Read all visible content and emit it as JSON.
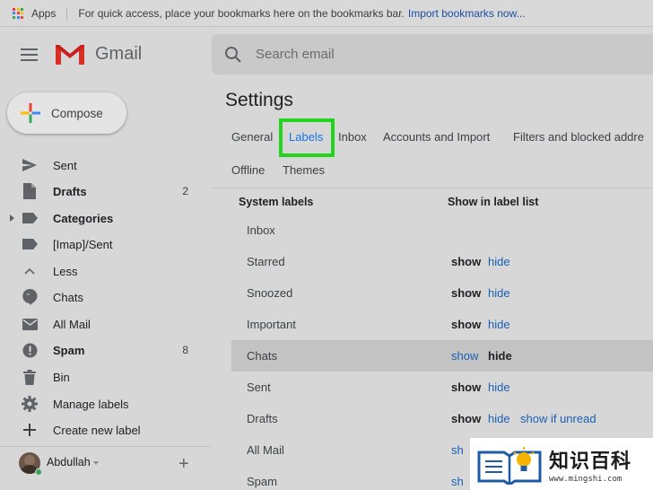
{
  "bookmarks_bar": {
    "apps_label": "Apps",
    "hint": "For quick access, place your bookmarks here on the bookmarks bar.",
    "import_link": "Import bookmarks now..."
  },
  "header": {
    "app_name": "Gmail",
    "search_placeholder": "Search email"
  },
  "compose_label": "Compose",
  "sidebar": {
    "items": [
      {
        "label": "Sent",
        "count": "",
        "icon": "send-icon",
        "bold": false
      },
      {
        "label": "Drafts",
        "count": "2",
        "icon": "draft-icon",
        "bold": true
      },
      {
        "label": "Categories",
        "count": "",
        "icon": "label-icon",
        "bold": true
      },
      {
        "label": "[Imap]/Sent",
        "count": "",
        "icon": "label-icon",
        "bold": false
      },
      {
        "label": "Less",
        "count": "",
        "icon": "chevron-up-icon",
        "bold": false
      },
      {
        "label": "Chats",
        "count": "",
        "icon": "chat-icon",
        "bold": false
      },
      {
        "label": "All Mail",
        "count": "",
        "icon": "mail-icon",
        "bold": false
      },
      {
        "label": "Spam",
        "count": "8",
        "icon": "spam-icon",
        "bold": true
      },
      {
        "label": "Bin",
        "count": "",
        "icon": "trash-icon",
        "bold": false
      },
      {
        "label": "Manage labels",
        "count": "",
        "icon": "gear-icon",
        "bold": false
      },
      {
        "label": "Create new label",
        "count": "",
        "icon": "plus-icon",
        "bold": false
      }
    ],
    "user_name": "Abdullah"
  },
  "main": {
    "title": "Settings",
    "tabs_row1": [
      "General",
      "Labels",
      "Inbox",
      "Accounts and Import",
      "Filters and blocked addre"
    ],
    "tabs_row2": [
      "Offline",
      "Themes"
    ],
    "active_tab": "Labels",
    "col_system_labels": "System labels",
    "col_show_in_list": "Show in label list",
    "rows": [
      {
        "name": "Inbox",
        "actions": []
      },
      {
        "name": "Starred",
        "actions": [
          "show",
          "hide"
        ]
      },
      {
        "name": "Snoozed",
        "actions": [
          "show",
          "hide"
        ]
      },
      {
        "name": "Important",
        "actions": [
          "show",
          "hide"
        ]
      },
      {
        "name": "Chats",
        "actions": [
          "show",
          "hide"
        ]
      },
      {
        "name": "Sent",
        "actions": [
          "show",
          "hide"
        ]
      },
      {
        "name": "Drafts",
        "actions": [
          "show",
          "hide",
          "show if unread"
        ]
      },
      {
        "name": "All Mail",
        "actions": [
          "sh"
        ]
      },
      {
        "name": "Spam",
        "actions": [
          "sh"
        ]
      }
    ]
  },
  "watermark": {
    "text": "知识百科",
    "url": "www.mingshi.com"
  },
  "colors": {
    "accent": "#1a73e8",
    "link": "#1a5fb4",
    "highlight_box": "#22d41e",
    "gmail_red": "#d93025"
  }
}
